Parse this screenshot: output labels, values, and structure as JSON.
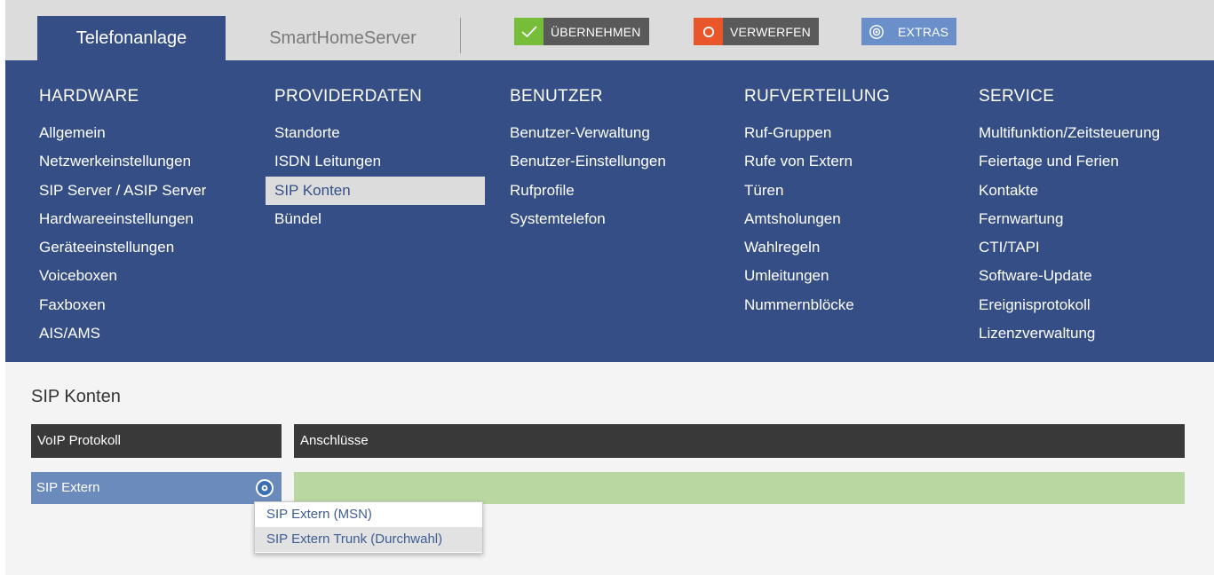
{
  "header": {
    "tabs": [
      {
        "label": "Telefonanlage",
        "active": true
      },
      {
        "label": "SmartHomeServer",
        "active": false
      }
    ],
    "actions": {
      "apply_label": "ÜBERNEHMEN",
      "discard_label": "VERWERFEN",
      "extras_label": "EXTRAS"
    }
  },
  "menu": {
    "columns": [
      {
        "title": "HARDWARE",
        "items": [
          "Allgemein",
          "Netzwerkeinstellungen",
          "SIP Server / ASIP Server",
          "Hardwareeinstellungen",
          "Geräteeinstellungen",
          "Voiceboxen",
          "Faxboxen",
          "AIS/AMS"
        ]
      },
      {
        "title": "PROVIDERDATEN",
        "items": [
          "Standorte",
          "ISDN Leitungen",
          "SIP Konten",
          "Bündel"
        ],
        "selected": "SIP Konten"
      },
      {
        "title": "BENUTZER",
        "items": [
          "Benutzer-Verwaltung",
          "Benutzer-Einstellungen",
          "Rufprofile",
          "Systemtelefon"
        ]
      },
      {
        "title": "RUFVERTEILUNG",
        "items": [
          "Ruf-Gruppen",
          "Rufe von Extern",
          "Türen",
          "Amtsholungen",
          "Wahlregeln",
          "Umleitungen",
          "Nummernblöcke"
        ]
      },
      {
        "title": "SERVICE",
        "items": [
          "Multifunktion/Zeitsteuerung",
          "Feiertage und Ferien",
          "Kontakte",
          "Fernwartung",
          "CTI/TAPI",
          "Software-Update",
          "Ereignisprotokoll",
          "Lizenzverwaltung"
        ]
      }
    ]
  },
  "content": {
    "title": "SIP Konten",
    "table": {
      "col_protocol": "VoIP Protokoll",
      "col_connections": "Anschlüsse",
      "row_protocol": "SIP Extern"
    },
    "dropdown": {
      "items": [
        "SIP Extern (MSN)",
        "SIP Extern Trunk (Durchwahl)"
      ]
    }
  },
  "colors": {
    "menu_bg": "#354f86",
    "apply_icon": "#76bd3a",
    "discard_icon": "#e8562a",
    "extras": "#6b8fc9",
    "row_protocol": "#6b8bbd",
    "row_connections": "#b9d8a1"
  },
  "icons": {
    "apply": "check-icon",
    "discard": "circle-icon",
    "extras": "gear-icon",
    "row_settings": "gear-icon"
  }
}
